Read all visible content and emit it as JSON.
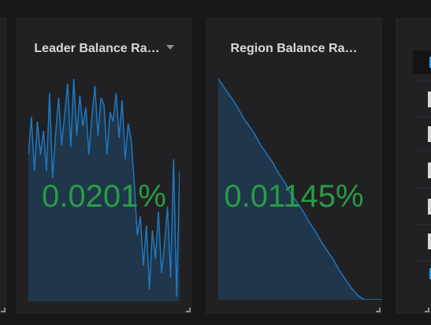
{
  "panels": [
    {
      "title": "Leader Balance Ra…",
      "value": "0.0201%",
      "has_menu": true
    },
    {
      "title": "Region Balance Ra…",
      "value": "0.01145%",
      "has_menu": false
    }
  ],
  "colors": {
    "background": "#161719",
    "panel": "#212124",
    "title": "#d8d9da",
    "value": "#299c46",
    "sparkline": "#1f78c1",
    "sparkfill": "#1f3a52"
  },
  "icons": {
    "menu": "chevron-down-icon",
    "resize": "resize-handle-icon"
  },
  "spark_series": {
    "leader": [
      0.62,
      0.78,
      0.55,
      0.76,
      0.62,
      0.72,
      0.55,
      0.88,
      0.52,
      0.71,
      0.86,
      0.66,
      0.79,
      0.92,
      0.65,
      0.94,
      0.7,
      0.87,
      0.74,
      0.82,
      0.62,
      0.78,
      0.91,
      0.7,
      0.86,
      0.83,
      0.62,
      0.8,
      0.76,
      0.88,
      0.69,
      0.85,
      0.6,
      0.75,
      0.68,
      0.5,
      0.28,
      0.36,
      0.15,
      0.32,
      0.05,
      0.3,
      0.18,
      0.38,
      0.12,
      0.24,
      0.4,
      0.1,
      0.6,
      0.02,
      0.55
    ],
    "region": [
      1.0,
      0.96,
      0.92,
      0.88,
      0.83,
      0.79,
      0.75,
      0.7,
      0.66,
      0.62,
      0.57,
      0.53,
      0.48,
      0.44,
      0.4,
      0.35,
      0.31,
      0.26,
      0.22,
      0.18,
      0.13,
      0.09,
      0.05,
      0.02,
      0.0,
      0.0,
      0.0,
      0.0
    ]
  }
}
